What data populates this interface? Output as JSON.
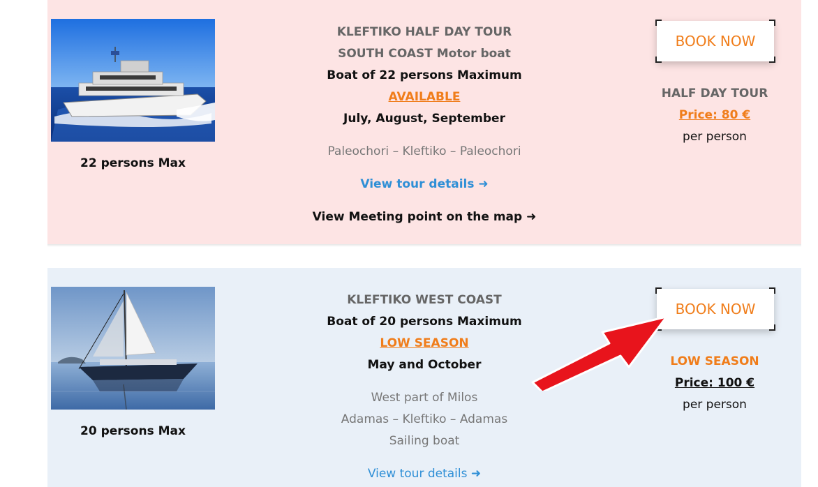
{
  "tours": [
    {
      "capacity_label": "22 persons Max",
      "lines": [
        "KLEFTIKO HALF DAY TOUR",
        "SOUTH COAST Motor boat",
        "Boat of 22 persons Maximum"
      ],
      "availability": "AVAILABLE",
      "season": "July, August, September",
      "route": [
        "Paleochori – Kleftiko – Paleochori"
      ],
      "details_link": "View tour details ➜",
      "map_link": "View Meeting point on the map ➜",
      "book_label": "BOOK NOW",
      "right_title": "HALF DAY TOUR",
      "price": "Price: 80 €",
      "per": "per person"
    },
    {
      "capacity_label": "20 persons Max",
      "lines": [
        "KLEFTIKO WEST COAST",
        "Boat of 20 persons Maximum"
      ],
      "availability": "LOW SEASON",
      "season": "May and October",
      "route": [
        "West part of Milos",
        "Adamas – Kleftiko – Adamas",
        "Sailing boat"
      ],
      "details_link": "View tour details ➜",
      "book_label": "BOOK NOW",
      "right_title": "LOW SEASON",
      "price": "Price: 100 €",
      "per": "per person"
    }
  ],
  "colors": {
    "accent": "#f07d1a",
    "link": "#2f8fd6",
    "card1_bg": "#fde4e4",
    "card2_bg": "#e9f0f8",
    "arrow": "#e8141c"
  },
  "icons": [
    "motor-boat-photo",
    "sailing-boat-photo",
    "red-pointer-arrow"
  ]
}
